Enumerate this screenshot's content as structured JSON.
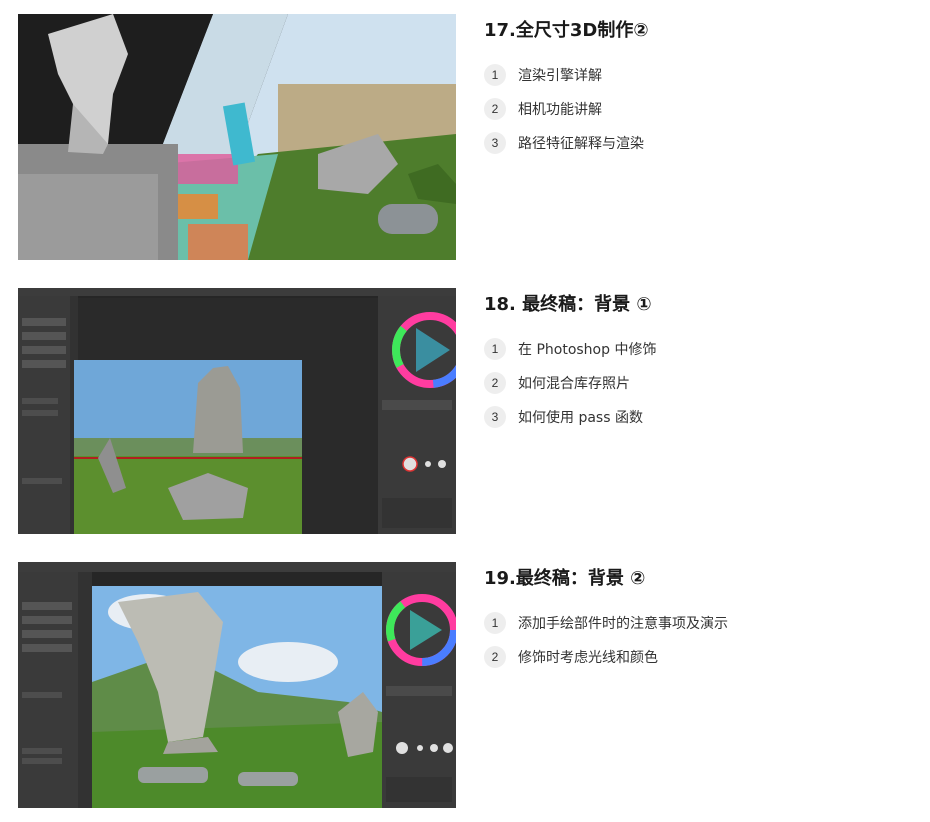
{
  "sections": [
    {
      "title": "17.全尺寸3D制作②",
      "items": [
        {
          "num": "1",
          "text": "渲染引擎详解"
        },
        {
          "num": "2",
          "text": "相机功能讲解"
        },
        {
          "num": "3",
          "text": "路径特征解释与渲染"
        }
      ]
    },
    {
      "title": "18. 最终稿：背景 ①",
      "items": [
        {
          "num": "1",
          "text": "在 Photoshop 中修饰"
        },
        {
          "num": "2",
          "text": "如何混合库存照片"
        },
        {
          "num": "3",
          "text": "如何使用 pass 函数"
        }
      ]
    },
    {
      "title": "19.最终稿：背景 ②",
      "items": [
        {
          "num": "1",
          "text": "添加手绘部件时的注意事项及演示"
        },
        {
          "num": "2",
          "text": "修饰时考虑光线和颜色"
        }
      ]
    }
  ],
  "colors": {
    "ps_dark": "#2b2b2b",
    "ps_panel": "#3a3a3a",
    "grass": "#4f8a2a",
    "sky": "#7fb6e6"
  }
}
